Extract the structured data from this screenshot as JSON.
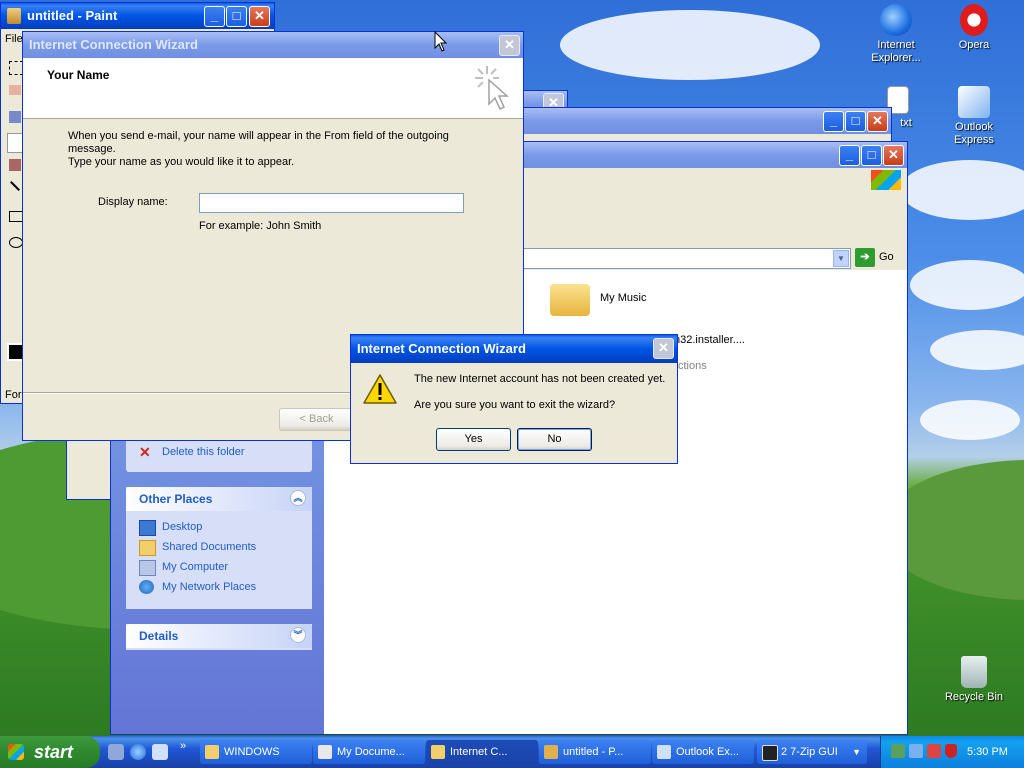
{
  "colors": {
    "xp_blue": "#0054e3",
    "task_link": "#215dc6",
    "face": "#ece9d8"
  },
  "desktop": {
    "icons": [
      {
        "label": "Internet Explorer...",
        "icon": "internet-explorer-icon"
      },
      {
        "label": "Opera",
        "icon": "opera-icon"
      },
      {
        "label": "txt",
        "icon": "text-file-icon"
      },
      {
        "label": "Outlook Express",
        "icon": "outlook-express-icon"
      },
      {
        "label": "Recycle Bin",
        "icon": "recycle-bin-icon"
      }
    ]
  },
  "paint": {
    "title": "untitled - Paint",
    "menu_first": "File",
    "status_snippet": "For"
  },
  "explorer": {
    "go_label": "Go",
    "folder_items": [
      {
        "label": "My Music",
        "icon": "music-folder-icon"
      },
      {
        "label": "n32.installer....",
        "icon": "installer-icon"
      },
      {
        "label": "ctions",
        "icon": ""
      }
    ],
    "tasks": {
      "delete_folder": "Delete this folder"
    },
    "other_places": {
      "title": "Other Places",
      "items": [
        "Desktop",
        "Shared Documents",
        "My Computer",
        "My Network Places"
      ]
    },
    "details": {
      "title": "Details"
    }
  },
  "wizard": {
    "title": "Internet Connection Wizard",
    "heading": "Your Name",
    "description_line1": "When you send e-mail, your name will appear in the From field of the outgoing message.",
    "description_line2": "Type your name as you would like it to appear.",
    "display_name_label": "Display name:",
    "display_name_value": "",
    "example": "For example: John Smith",
    "back_button": "< Back"
  },
  "dialog": {
    "title": "Internet Connection Wizard",
    "message1": "The new Internet account has not been created yet.",
    "message2": "Are you sure you want to exit the wizard?",
    "yes": "Yes",
    "no": "No"
  },
  "taskbar": {
    "start": "start",
    "items": [
      {
        "label": "WINDOWS",
        "icon": "folder-icon"
      },
      {
        "label": "My Docume...",
        "icon": "documents-icon"
      },
      {
        "label": "Internet C...",
        "icon": "folder-icon"
      },
      {
        "label": "untitled - P...",
        "icon": "paint-icon"
      },
      {
        "label": "Outlook Ex...",
        "icon": "outlook-icon"
      },
      {
        "label": "2 7-Zip GUI",
        "icon": "7zip-icon"
      }
    ],
    "clock": "5:30 PM"
  }
}
